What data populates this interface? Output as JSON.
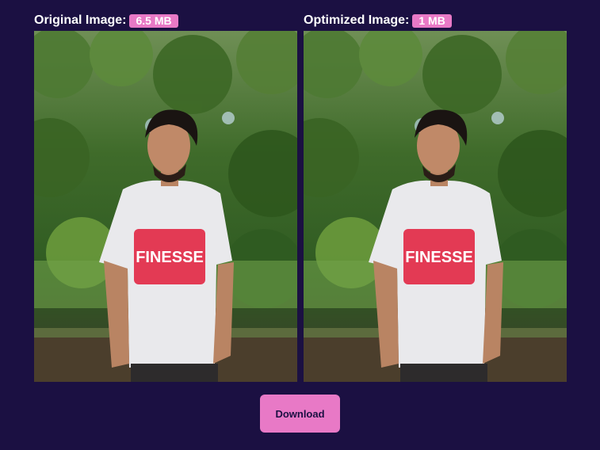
{
  "original": {
    "title": "Original Image:",
    "size": "6.5 MB"
  },
  "optimized": {
    "title": "Optimized Image:",
    "size": "1 MB"
  },
  "photo": {
    "shirt_text": "FINESSE"
  },
  "download": {
    "label": "Download"
  },
  "colors": {
    "background": "#1b1042",
    "accent": "#e879c6",
    "text": "#ffffff"
  }
}
